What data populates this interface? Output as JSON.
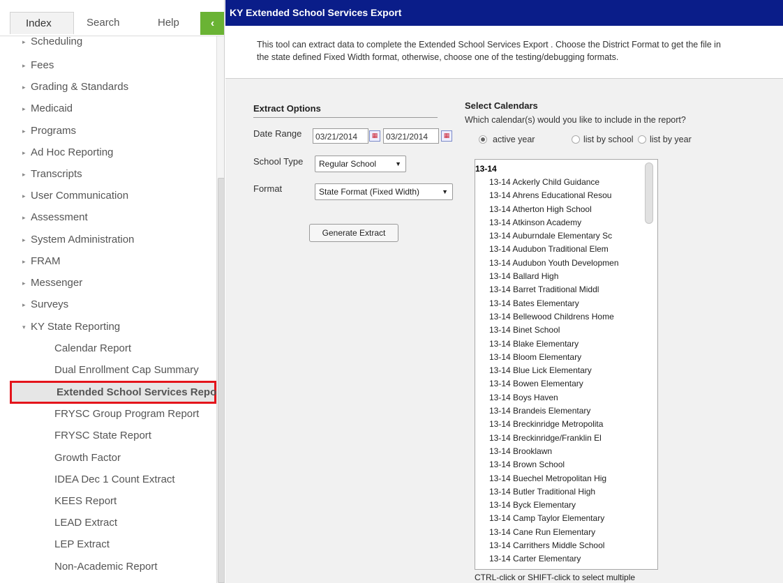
{
  "nav": {
    "tabs": [
      "Index",
      "Search",
      "Help"
    ],
    "collapse_icon": "chevron-left-icon",
    "items": [
      {
        "label": "Scheduling"
      },
      {
        "label": "Fees"
      },
      {
        "label": "Grading & Standards"
      },
      {
        "label": "Medicaid"
      },
      {
        "label": "Programs"
      },
      {
        "label": "Ad Hoc Reporting"
      },
      {
        "label": "Transcripts"
      },
      {
        "label": "User Communication"
      },
      {
        "label": "Assessment"
      },
      {
        "label": "System Administration"
      },
      {
        "label": "FRAM"
      },
      {
        "label": "Messenger"
      },
      {
        "label": "Surveys"
      },
      {
        "label": "KY State Reporting"
      }
    ],
    "subitems": [
      "Calendar Report",
      "Dual Enrollment Cap Summary",
      "Extended School Services Repo",
      "FRYSC Group Program Report",
      "FRYSC State Report",
      "Growth Factor",
      "IDEA Dec 1 Count Extract",
      "KEES Report",
      "LEAD Extract",
      "LEP Extract",
      "Non-Academic Report"
    ]
  },
  "header": {
    "title": "KY Extended School Services Export",
    "description_line1": "This tool can extract data to complete the Extended School Services Export . Choose the District Format to get the file in",
    "description_line2": "the state defined Fixed Width format, otherwise, choose one of the testing/debugging formats."
  },
  "extract": {
    "heading": "Extract Options",
    "date_label": "Date Range",
    "date_start": "03/21/2014",
    "date_end": "03/21/2014",
    "school_type_label": "School Type",
    "school_type_value": "Regular School",
    "format_label": "Format",
    "format_value": "State Format (Fixed Width)",
    "generate_label": "Generate Extract"
  },
  "calendars": {
    "heading": "Select Calendars",
    "question": "Which calendar(s) would you like to include in the report?",
    "radio": [
      "active year",
      "list by school",
      "list by year"
    ],
    "selected_radio": "active year",
    "group": "13-14",
    "options": [
      "13-14 Ackerly Child Guidance",
      "13-14 Ahrens Educational Resou",
      "13-14 Atherton High School",
      "13-14 Atkinson Academy",
      "13-14 Auburndale Elementary Sc",
      "13-14 Audubon Traditional Elem",
      "13-14 Audubon Youth Developmen",
      "13-14 Ballard High",
      "13-14 Barret Traditional Middl",
      "13-14 Bates Elementary",
      "13-14 Bellewood Childrens Home",
      "13-14 Binet School",
      "13-14 Blake Elementary",
      "13-14 Bloom Elementary",
      "13-14 Blue Lick Elementary",
      "13-14 Bowen Elementary",
      "13-14 Boys Haven",
      "13-14 Brandeis Elementary",
      "13-14 Breckinridge Metropolita",
      "13-14 Breckinridge/Franklin El",
      "13-14 Brooklawn",
      "13-14 Brown School",
      "13-14 Buechel Metropolitan Hig",
      "13-14 Butler Traditional High",
      "13-14 Byck Elementary",
      "13-14 Camp Taylor Elementary",
      "13-14 Cane Run Elementary",
      "13-14 Carrithers Middle School",
      "13-14 Carter Elementary"
    ],
    "hint": "CTRL-click or SHIFT-click to select multiple"
  },
  "colors": {
    "header_bg": "#0a1d89",
    "collapse_bg": "#6ab334",
    "selected_border": "#e4141b"
  }
}
